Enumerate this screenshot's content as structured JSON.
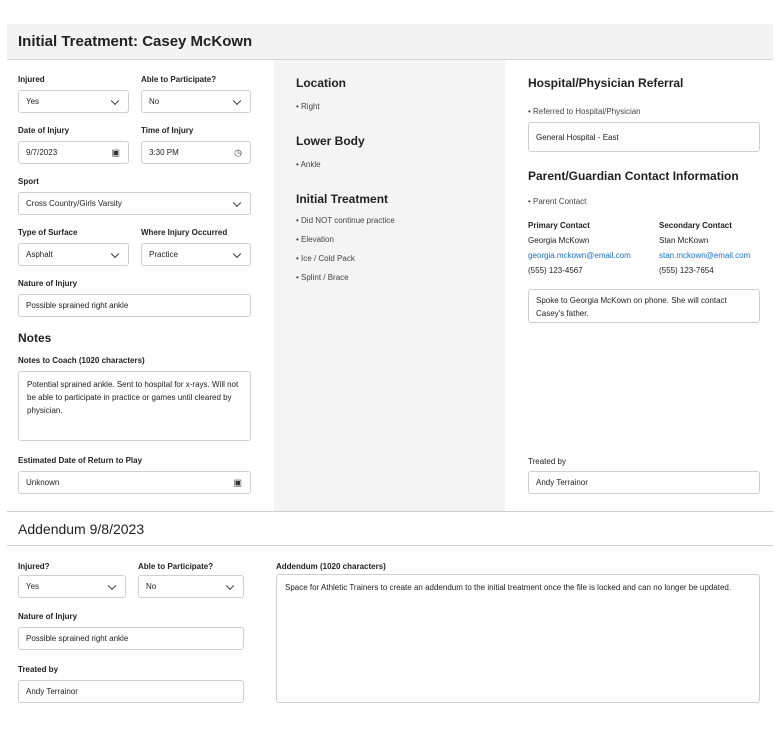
{
  "header": {
    "title": "Initial Treatment: Casey McKown"
  },
  "form": {
    "injured_label": "Injured",
    "injured_value": "Yes",
    "able_label": "Able to Participate?",
    "able_value": "No",
    "doi_label": "Date of Injury",
    "doi_value": "9/7/2023",
    "toi_label": "Time of Injury",
    "toi_value": "3:30 PM",
    "sport_label": "Sport",
    "sport_value": "Cross Country/Girls Varsity",
    "surface_label": "Type of Surface",
    "surface_value": "Asphalt",
    "where_label": "Where Injury Occurred",
    "where_value": "Practice",
    "nature_label": "Nature of Injury",
    "nature_value": "Possible sprained right ankle"
  },
  "notes": {
    "heading": "Notes",
    "label": "Notes to Coach (1020 characters)",
    "value": "Potential sprained ankle. Sent to hospital for x-rays. Will not be able to participate in practice or games until cleared by physician.",
    "return_label": "Estimated Date of Return to Play",
    "return_value": "Unknown"
  },
  "middle": {
    "location_heading": "Location",
    "location_items": [
      "• Right"
    ],
    "lower_heading": "Lower Body",
    "lower_items": [
      "• Ankle"
    ],
    "treatment_heading": "Initial Treatment",
    "treatment_items": [
      "• Did NOT continue practice",
      "• Elevation",
      "• Ice / Cold Pack",
      "• Splint / Brace"
    ]
  },
  "right": {
    "referral_heading": "Hospital/Physician Referral",
    "referral_bullet": "• Referred to Hospital/Physician",
    "referral_value": "General Hospital - East",
    "contact_heading": "Parent/Guardian Contact Information",
    "contact_bullet": "• Parent Contact",
    "primary_label": "Primary Contact",
    "primary_name": "Georgia McKown",
    "primary_email": "georgia.mckown@email.com",
    "primary_phone": "(555) 123-4567",
    "secondary_label": "Secondary Contact",
    "secondary_name": "Stan McKown",
    "secondary_email": "stan.mckown@email.com",
    "secondary_phone": "(555) 123-7654",
    "contact_note": "Spoke to Georgia McKown on phone. She will contact Casey's father.",
    "treated_label": "Treated by",
    "treated_value": "Andy Terrainor"
  },
  "addendum": {
    "title": "Addendum 9/8/2023",
    "injured_label": "Injured?",
    "injured_value": "Yes",
    "able_label": "Able to Participate?",
    "able_value": "No",
    "nature_label": "Nature of Injury",
    "nature_value": "Possible sprained right ankle",
    "treated_label": "Treated by",
    "treated_value": "Andy Terrainor",
    "text_label": "Addendum (1020 characters)",
    "text_value": "Space for Athletic Trainers to create an addendum to the initial treatment once the file is locked and can no longer be updated."
  }
}
